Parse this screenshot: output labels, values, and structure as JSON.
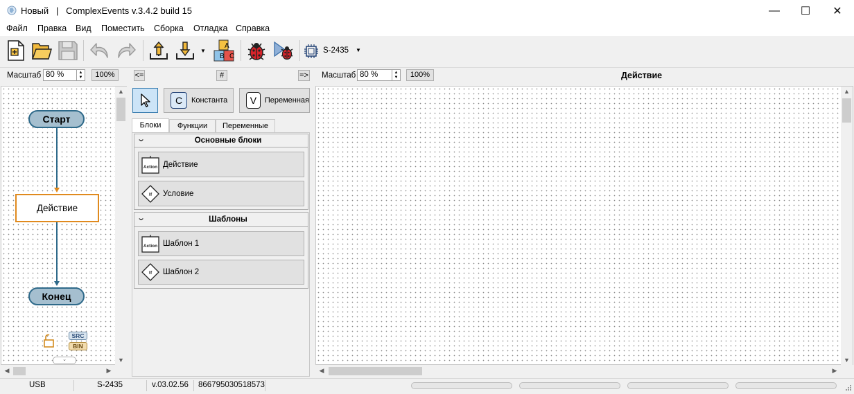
{
  "window": {
    "title": "Новый   |   ComplexEvents v.3.4.2 build 15",
    "minimize": "—",
    "maximize": "☐",
    "close": "✕"
  },
  "menu": [
    "Файл",
    "Правка",
    "Вид",
    "Поместить",
    "Сборка",
    "Отладка",
    "Справка"
  ],
  "toolbar": {
    "device": "S-2435",
    "abc_letters": [
      "A",
      "B",
      "C"
    ]
  },
  "left_zoom": {
    "label": "Масштаб",
    "value": "80 %",
    "reset": "100%"
  },
  "nav": {
    "left": "<=",
    "grid": "#",
    "right": "=>"
  },
  "right_zoom": {
    "label": "Масштаб",
    "value": "80 %",
    "reset": "100%"
  },
  "editor_title": "Действие",
  "flowchart": {
    "start": "Старт",
    "action": "Действие",
    "end": "Конец",
    "badges": [
      "SRC",
      "BIN"
    ]
  },
  "tools": {
    "constant_letter": "C",
    "constant": "Константа",
    "variable_letter": "V",
    "variable": "Переменная"
  },
  "tabs": [
    "Блоки",
    "Функции",
    "Переменные"
  ],
  "groups": {
    "basic": {
      "title": "Основные блоки",
      "items": [
        {
          "icon": "Action",
          "label": "Действие"
        },
        {
          "icon": "If",
          "label": "Условие"
        }
      ]
    },
    "templates": {
      "title": "Шаблоны",
      "items": [
        {
          "icon": "Action",
          "label": "Шаблон 1"
        },
        {
          "icon": "If",
          "label": "Шаблон 2"
        }
      ]
    }
  },
  "status": {
    "port": "USB",
    "device": "S-2435",
    "version": "v.03.02.56",
    "serial": "866795030518573"
  },
  "colors": {
    "pill_fill": "#a5bfcf",
    "flow_line": "#2f6a8a",
    "action_border": "#e08a1e",
    "bug_red": "#d8232a"
  }
}
